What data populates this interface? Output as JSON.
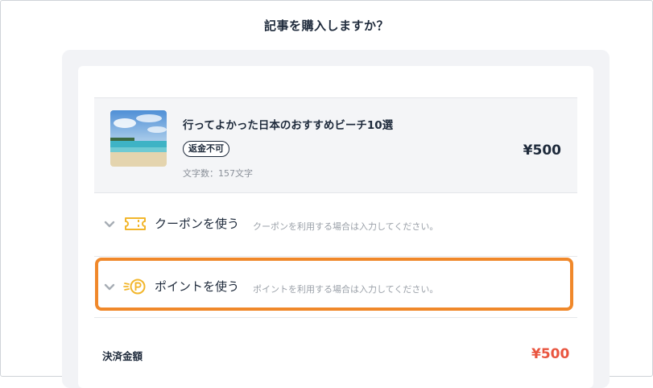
{
  "dialog": {
    "title": "記事を購入しますか？"
  },
  "article": {
    "title": "行ってよかった日本のおすすめビーチ10選",
    "badge": "返金不可",
    "char_count": "文字数：157文字",
    "price": "¥500",
    "thumbnail_icon": "beach-thumbnail"
  },
  "coupon": {
    "label": "クーポンを使う",
    "hint": "クーポンを利用する場合は入力してください。",
    "icon": "ticket-icon"
  },
  "point": {
    "label": "ポイントを使う",
    "hint": "ポイントを利用する場合は入力してください。",
    "icon": "point-coin-icon"
  },
  "total": {
    "label": "決済金額",
    "price": "¥500"
  },
  "colors": {
    "accent_orange": "#f0882a",
    "icon_yellow": "#f2b62b",
    "total_red": "#e9553f",
    "text_dark": "#1e2a3b"
  }
}
